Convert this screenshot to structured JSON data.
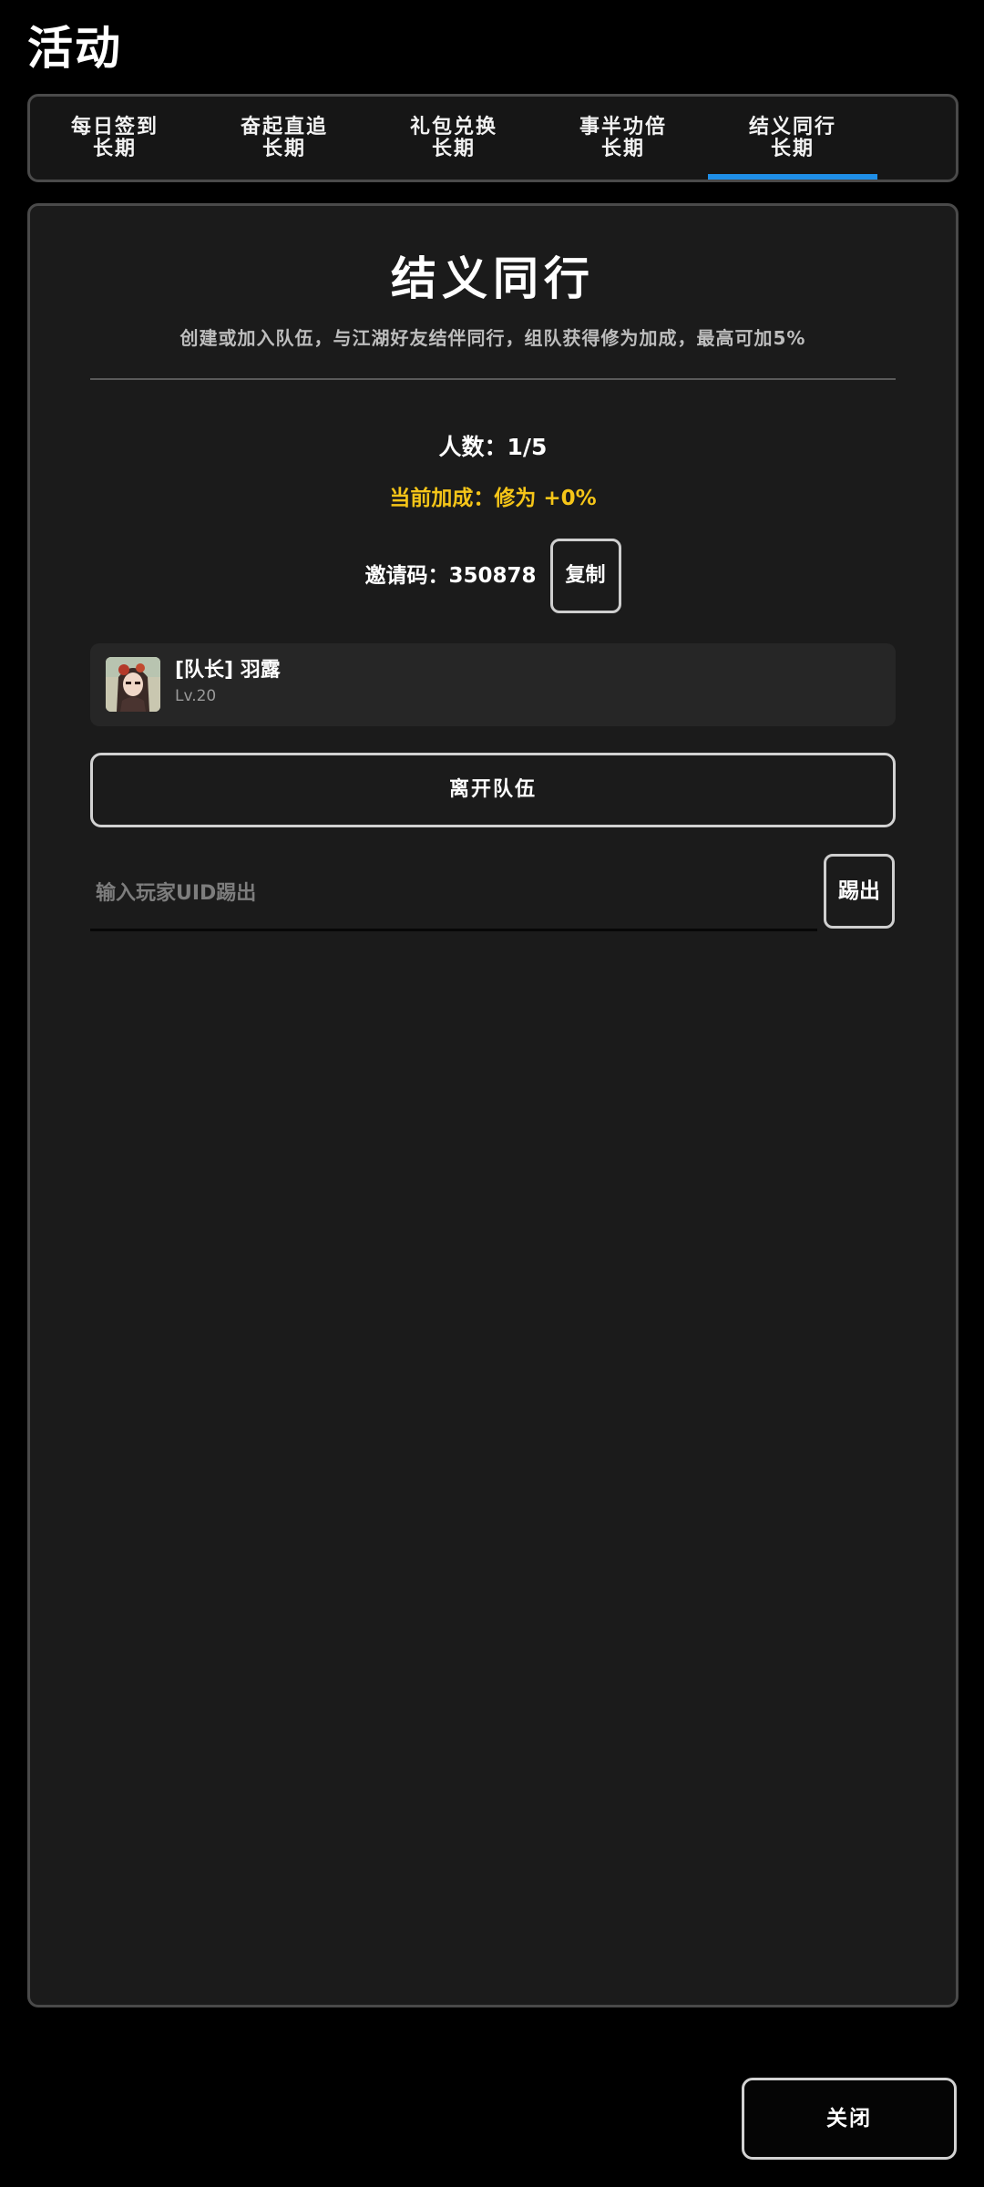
{
  "header": {
    "title": "活动"
  },
  "tabs": [
    {
      "label": "每日签到",
      "sublabel": "长期",
      "active": false
    },
    {
      "label": "奋起直追",
      "sublabel": "长期",
      "active": false
    },
    {
      "label": "礼包兑换",
      "sublabel": "长期",
      "active": false
    },
    {
      "label": "事半功倍",
      "sublabel": "长期",
      "active": false
    },
    {
      "label": "结义同行",
      "sublabel": "长期",
      "active": true
    }
  ],
  "panel": {
    "title": "结义同行",
    "description": "创建或加入队伍，与江湖好友结伴同行，组队获得修为加成，最高可加5%",
    "member_count": "人数：1/5",
    "bonus": "当前加成：修为 +0%",
    "invite_text": "邀请码：350878",
    "copy_label": "复制",
    "members": [
      {
        "name": "[队长] 羽露",
        "level": "Lv.20"
      }
    ],
    "leave_label": "离开队伍",
    "kick_placeholder": "输入玩家UID踢出",
    "kick_value": "",
    "kick_label": "踢出"
  },
  "footer": {
    "close_label": "关闭"
  },
  "colors": {
    "accent": "#1f8fe8",
    "bonus": "#f5c518",
    "panel_bg": "#1b1b1b",
    "card_bg": "#262626"
  }
}
